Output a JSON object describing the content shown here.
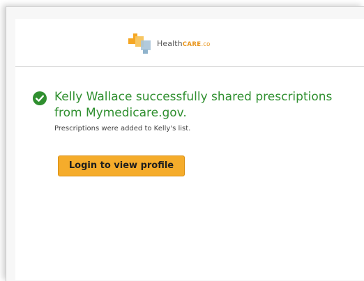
{
  "header": {
    "logo": {
      "icon": "healthcare-logo-icon",
      "name_health": "Health",
      "name_care": "CARE",
      "name_suffix": ".co"
    }
  },
  "main": {
    "status_icon": "check-circle-icon",
    "message": "Kelly Wallace successfully shared prescriptions from Mymedicare.gov.",
    "subtext": "Prescriptions were added to Kelly's list.",
    "login_button_label": "Login to view profile"
  },
  "colors": {
    "success": "#2f8f2f",
    "button": "#f5ac2b",
    "logo_orange": "#f5a623",
    "logo_blue": "#a9c4d8"
  }
}
